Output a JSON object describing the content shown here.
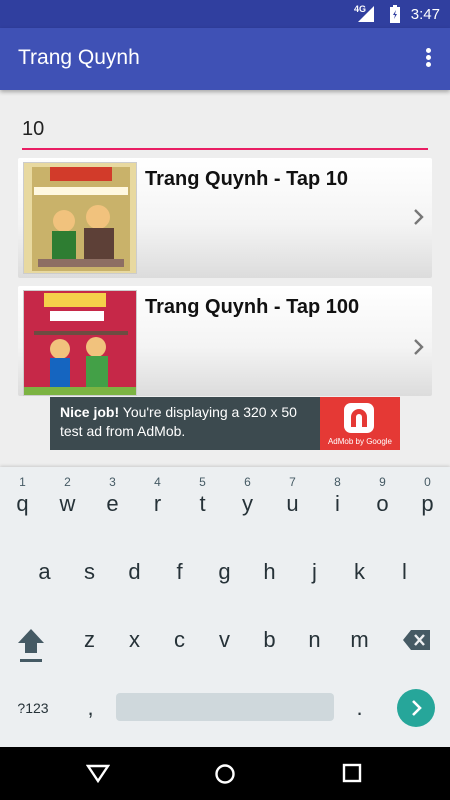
{
  "status_bar": {
    "network": "4G",
    "time": "3:47"
  },
  "app_bar": {
    "title": "Trang Quynh",
    "menu_icon": "more-vert-icon"
  },
  "search": {
    "value": "10"
  },
  "list": {
    "items": [
      {
        "title": "Trang Quynh - Tap 10",
        "thumb_caption": "VONG NGOC TRUNG QUOC"
      },
      {
        "title": "Trang Quynh - Tap 100",
        "thumb_caption": "Y TROI"
      }
    ]
  },
  "ad": {
    "headline": "Nice job!",
    "body": " You're displaying a 320 x 50 test ad from AdMob.",
    "brand_by": "AdMob by Google",
    "brand_color": "#e53935"
  },
  "keyboard": {
    "row1": [
      {
        "k": "q",
        "h": "1"
      },
      {
        "k": "w",
        "h": "2"
      },
      {
        "k": "e",
        "h": "3"
      },
      {
        "k": "r",
        "h": "4"
      },
      {
        "k": "t",
        "h": "5"
      },
      {
        "k": "y",
        "h": "6"
      },
      {
        "k": "u",
        "h": "7"
      },
      {
        "k": "i",
        "h": "8"
      },
      {
        "k": "o",
        "h": "9"
      },
      {
        "k": "p",
        "h": "0"
      }
    ],
    "row2": [
      "a",
      "s",
      "d",
      "f",
      "g",
      "h",
      "j",
      "k",
      "l"
    ],
    "row3": [
      "z",
      "x",
      "c",
      "v",
      "b",
      "n",
      "m"
    ],
    "symbols": "?123",
    "comma": ",",
    "period": "."
  },
  "colors": {
    "primary": "#3f51b5",
    "primary_dark": "#303f9f",
    "accent": "#e91e63",
    "go_key": "#26a69a"
  }
}
